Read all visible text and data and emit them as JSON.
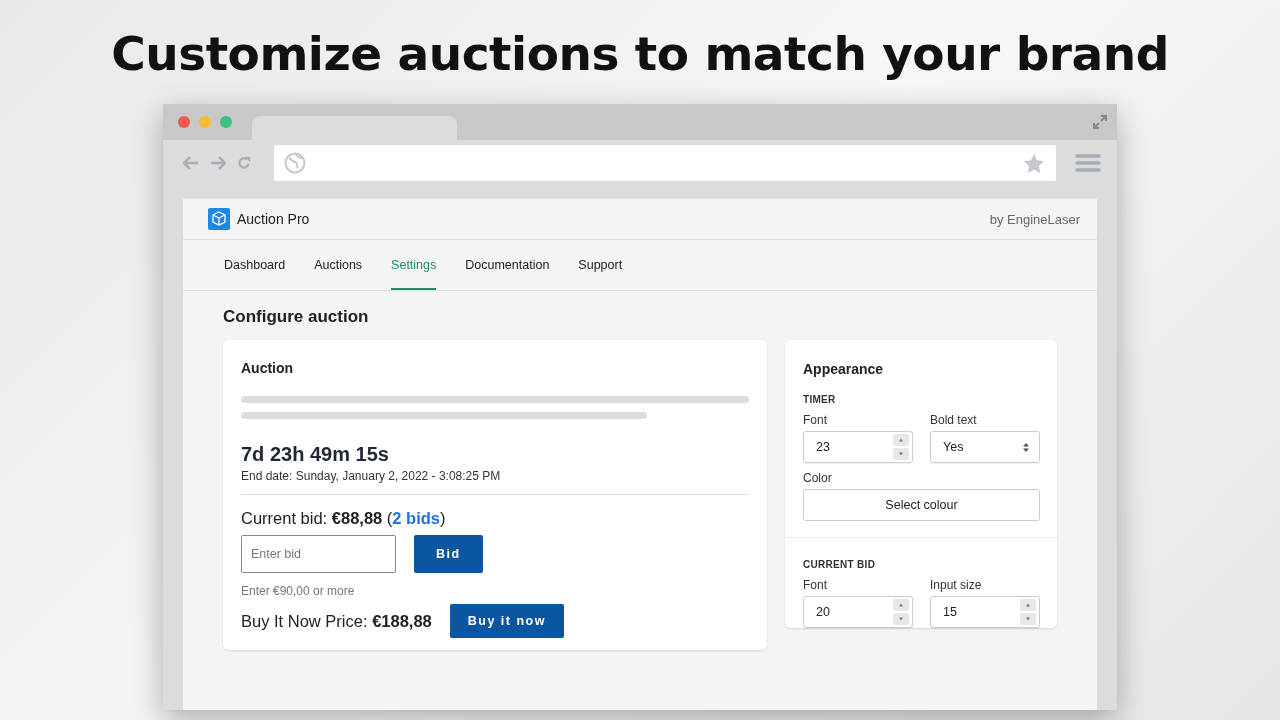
{
  "headline": "Customize auctions to match your brand",
  "app": {
    "name": "Auction Pro",
    "vendor": "by EngineLaser"
  },
  "tabs": [
    {
      "label": "Dashboard",
      "selected": false
    },
    {
      "label": "Auctions",
      "selected": false
    },
    {
      "label": "Settings",
      "selected": true
    },
    {
      "label": "Documentation",
      "selected": false
    },
    {
      "label": "Support",
      "selected": false
    }
  ],
  "page_title": "Configure auction",
  "auction_card": {
    "title": "Auction",
    "countdown": "7d 23h 49m 15s",
    "end_date": "End date: Sunday, January 2, 2022 - 3:08:25 PM",
    "current_bid": {
      "text": "Current bid: **€88,88** (",
      "link": "2 bids",
      "close": ")"
    },
    "bid_input": {
      "placeholder": "Enter bid"
    },
    "bid_button": "Bid",
    "hint": "Enter €90,00 or more",
    "buy_now": "Buy It Now Price: **€188,88**",
    "buy_button": "Buy it now"
  },
  "appearance": {
    "title": "Appearance",
    "sections": [
      {
        "heading": "TIMER",
        "fields": [
          {
            "label": "Font",
            "kind": "number",
            "value": "23"
          },
          {
            "label": "Bold text",
            "kind": "select",
            "value": "Yes"
          },
          {
            "label": "Color",
            "kind": "button",
            "value": "Select colour"
          }
        ]
      },
      {
        "heading": "CURRENT BID",
        "fields": [
          {
            "label": "Font",
            "kind": "number",
            "value": "20"
          },
          {
            "label": "Input size",
            "kind": "number",
            "value": "15"
          }
        ]
      }
    ]
  }
}
